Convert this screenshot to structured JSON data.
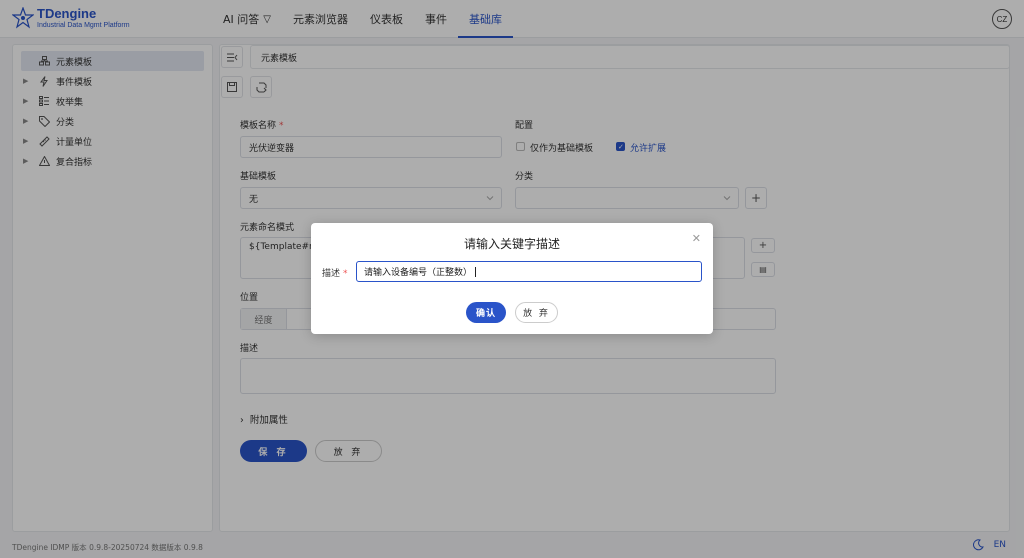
{
  "app": {
    "logo_title": "TDengine",
    "logo_subtitle": "Industrial Data Mgmt Platform",
    "avatar_initials": "CZ",
    "accent_color": "#2a54c9"
  },
  "nav": {
    "items": [
      {
        "label": "AI 问答"
      },
      {
        "label": "元素浏览器"
      },
      {
        "label": "仪表板"
      },
      {
        "label": "事件"
      },
      {
        "label": "基础库"
      }
    ],
    "active": "基础库"
  },
  "sidebar": {
    "items": [
      {
        "label": "元素模板",
        "icon": "element-template-icon"
      },
      {
        "label": "事件模板",
        "icon": "lightning-icon"
      },
      {
        "label": "枚举集",
        "icon": "list-icon"
      },
      {
        "label": "分类",
        "icon": "tag-icon"
      },
      {
        "label": "计量单位",
        "icon": "ruler-icon"
      },
      {
        "label": "复合指标",
        "icon": "triangle-icon"
      }
    ]
  },
  "breadcrumb": {
    "text": "元素模板"
  },
  "form": {
    "name_label": "模板名称",
    "name_value": "光伏逆变器",
    "config_label": "配置",
    "only_base_label": "仅作为基础模板",
    "allow_extend_label": "允许扩展",
    "base_template_label": "基础模板",
    "base_template_value": "无",
    "category_label": "分类",
    "naming_label": "元素命名模式",
    "naming_value": "${Template#na",
    "location_label": "位置",
    "longitude_label": "经度",
    "description_label": "描述",
    "extra_attrs_label": "附加属性",
    "save_label": "保 存",
    "discard_label": "放 弃"
  },
  "footer": {
    "version_text": "TDengine IDMP 版本 0.9.8-20250724 数据版本 0.9.8",
    "lang": "EN"
  },
  "modal": {
    "title": "请输入关键字描述",
    "field_label": "描述",
    "field_value": "请输入设备编号（正整数）",
    "confirm_label": "确认",
    "discard_label": "放 弃"
  }
}
